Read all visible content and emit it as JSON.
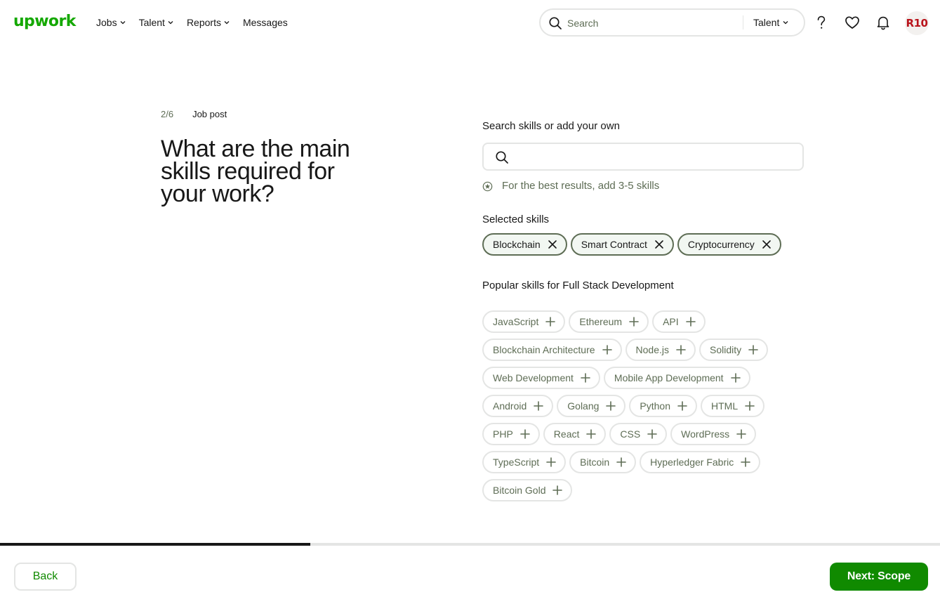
{
  "header": {
    "logo": "upwork",
    "nav": [
      {
        "label": "Jobs",
        "has_dropdown": true
      },
      {
        "label": "Talent",
        "has_dropdown": true
      },
      {
        "label": "Reports",
        "has_dropdown": true
      },
      {
        "label": "Messages",
        "has_dropdown": false
      }
    ],
    "search": {
      "placeholder": "Search",
      "value": "",
      "type_label": "Talent"
    },
    "icons": [
      "help-icon",
      "heart-icon",
      "bell-icon"
    ],
    "avatar_text": "R10"
  },
  "step": {
    "number": "2/6",
    "label": "Job post"
  },
  "title": "What are the main skills required for your work?",
  "skills_search": {
    "label": "Search skills or add your own",
    "value": ""
  },
  "hint": "For the best results, add 3-5 skills",
  "selected": {
    "label": "Selected skills",
    "items": [
      "Blockchain",
      "Smart Contract",
      "Cryptocurrency"
    ]
  },
  "popular": {
    "label": "Popular skills for Full Stack Development",
    "items": [
      "JavaScript",
      "Ethereum",
      "API",
      "Blockchain Architecture",
      "Node.js",
      "Solidity",
      "Web Development",
      "Mobile App Development",
      "Android",
      "Golang",
      "Python",
      "HTML",
      "PHP",
      "React",
      "CSS",
      "WordPress",
      "TypeScript",
      "Bitcoin",
      "Hyperledger Fabric",
      "Bitcoin Gold"
    ]
  },
  "progress": {
    "step": 2,
    "total": 6,
    "fraction": 0.33
  },
  "footer": {
    "back_label": "Back",
    "next_label": "Next: Scope"
  },
  "colors": {
    "brand": "#14a800",
    "button": "#108a00",
    "avatar_text": "#b9141c"
  }
}
